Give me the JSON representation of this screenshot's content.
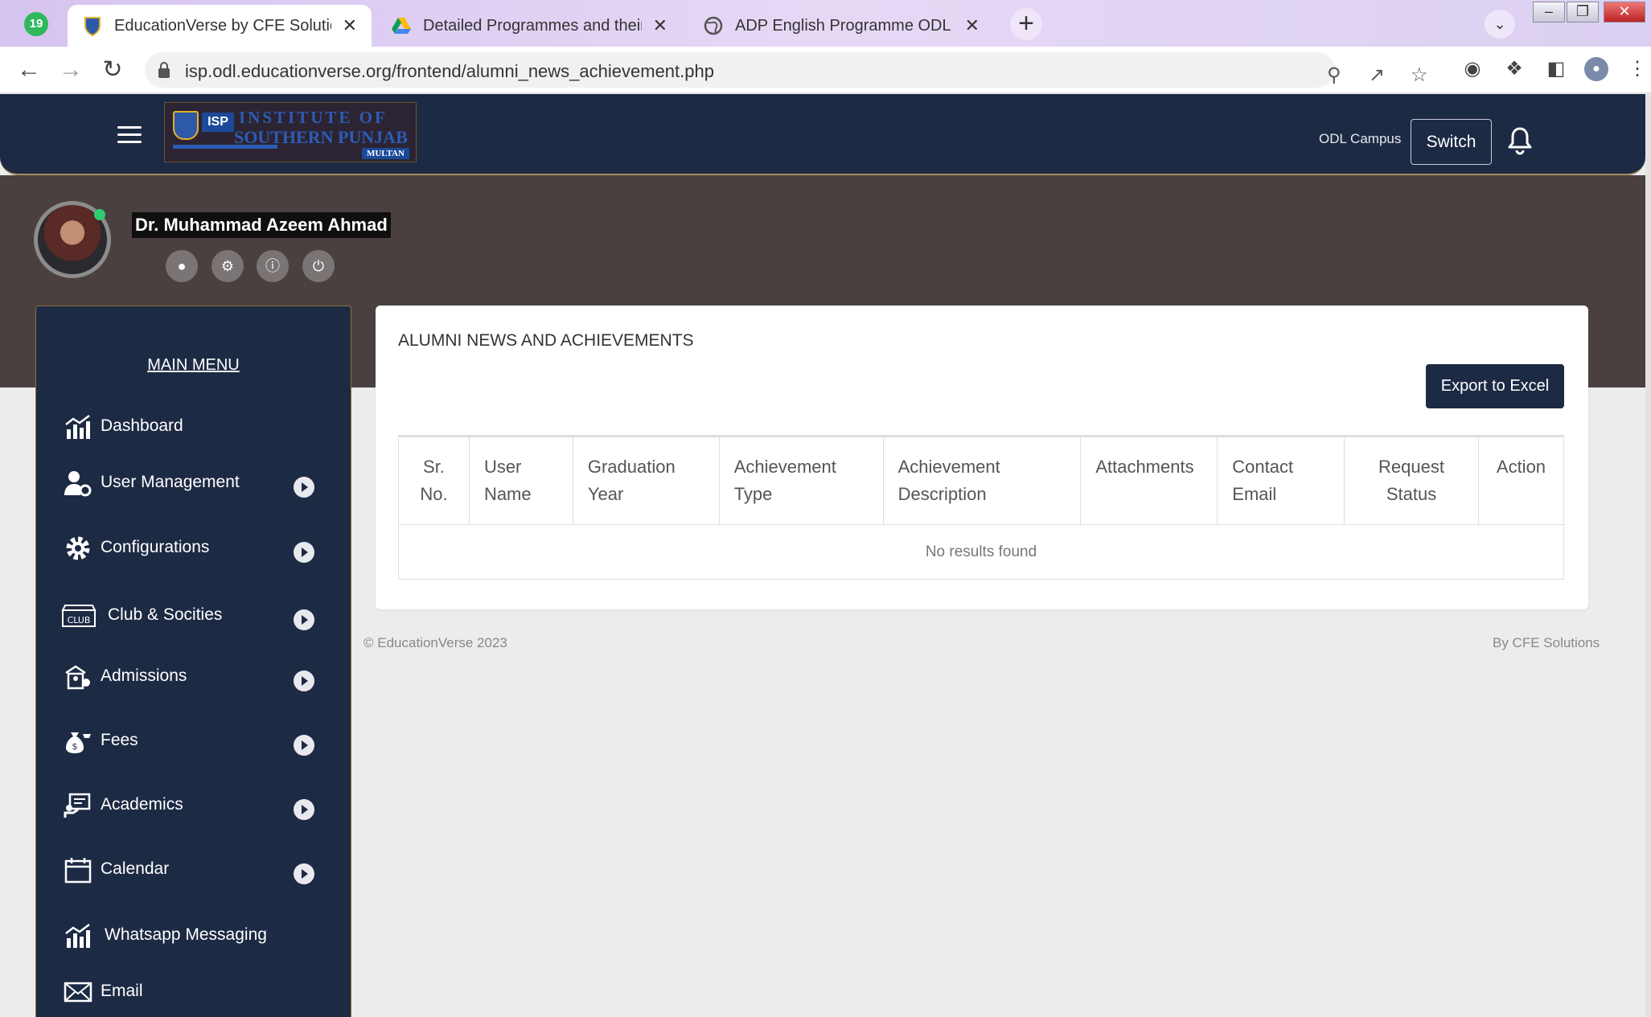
{
  "browser": {
    "tab_count": "19",
    "tabs": [
      {
        "label": "EducationVerse by CFE Solutions"
      },
      {
        "label": "Detailed Programmes and their a"
      },
      {
        "label": "ADP English Programme ODL - C"
      }
    ],
    "close_glyph": "✕",
    "new_tab": "+",
    "url": "isp.odl.educationverse.org/frontend/alumni_news_achievement.php"
  },
  "header": {
    "logo": {
      "badge": "ISP",
      "line1": "INSTITUTE OF",
      "line2": "SOUTHERN PUNJAB",
      "line3": "MULTAN"
    },
    "campus_label": "ODL Campus",
    "switch_label": "Switch"
  },
  "profile": {
    "name": "Dr. Muhammad Azeem Ahmad"
  },
  "sidebar": {
    "title": "MAIN MENU",
    "items": [
      {
        "label": "Dashboard",
        "icon": "chart-icon",
        "has_submenu": false
      },
      {
        "label": "User Management",
        "icon": "user-gear-icon",
        "has_submenu": true
      },
      {
        "label": "Configurations",
        "icon": "gear-icon",
        "has_submenu": true
      },
      {
        "label": "Club & Socities",
        "icon": "club-icon",
        "has_submenu": true
      },
      {
        "label": "Admissions",
        "icon": "admissions-icon",
        "has_submenu": true
      },
      {
        "label": "Fees",
        "icon": "money-bag-icon",
        "has_submenu": true
      },
      {
        "label": "Academics",
        "icon": "academics-icon",
        "has_submenu": true
      },
      {
        "label": "Calendar",
        "icon": "calendar-icon",
        "has_submenu": true
      },
      {
        "label": "Whatsapp Messaging",
        "icon": "chart-icon",
        "has_submenu": false
      },
      {
        "label": "Email",
        "icon": "envelope-icon",
        "has_submenu": false
      }
    ]
  },
  "main": {
    "title": "ALUMNI NEWS AND ACHIEVEMENTS",
    "export_label": "Export to Excel",
    "table": {
      "headers": [
        "Sr. No.",
        "User Name",
        "Graduation Year",
        "Achievement Type",
        "Achievement Description",
        "Attachments",
        "Contact Email",
        "Request Status",
        "Action"
      ],
      "empty_message": "No results found"
    }
  },
  "footer": {
    "copyright": "© EducationVerse 2023",
    "credit": "By CFE Solutions"
  },
  "colors": {
    "navy": "#1d2a44",
    "band": "#4b4040",
    "gold_border": "#a58b5c",
    "online": "#2ecc71"
  }
}
